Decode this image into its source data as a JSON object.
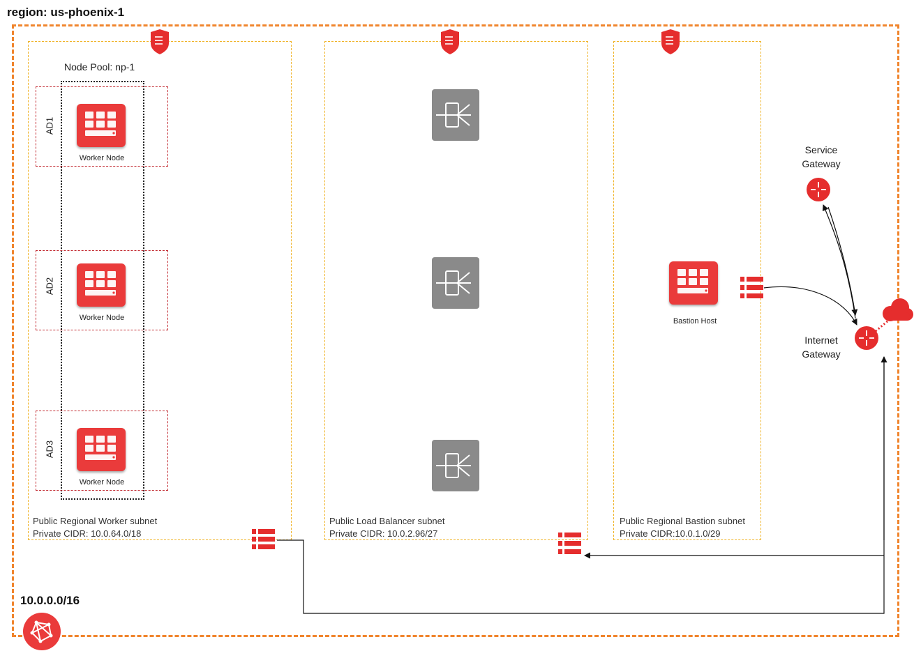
{
  "region": {
    "title": "region: us-phoenix-1"
  },
  "vcn": {
    "cidr": "10.0.0.0/16",
    "icon": "vcn-network-icon"
  },
  "worker_subnet": {
    "name": "Public Regional Worker subnet",
    "cidr": "Private CIDR: 10.0.64.0/18",
    "node_pool": "Node Pool: np-1",
    "nodes": [
      {
        "ad": "AD1",
        "label": "Worker Node"
      },
      {
        "ad": "AD2",
        "label": "Worker Node"
      },
      {
        "ad": "AD3",
        "label": "Worker Node"
      }
    ]
  },
  "lb_subnet": {
    "name": "Public Load Balancer subnet",
    "cidr": "Private CIDR: 10.0.2.96/27",
    "load_balancers": 3
  },
  "bastion_subnet": {
    "name": "Public Regional Bastion subnet",
    "cidr": "Private CIDR:10.0.1.0/29",
    "host_label": "Bastion Host"
  },
  "gateways": {
    "service_line1": "Service",
    "service_line2": "Gateway",
    "internet_line1": "Internet",
    "internet_line2": "Gateway"
  },
  "colors": {
    "vcn_border": "#f0852d",
    "subnet_border": "#f0b429",
    "ad_border": "#c22a31",
    "oracle_red": "#ea3b3b",
    "lb_gray": "#8a8a8a"
  }
}
